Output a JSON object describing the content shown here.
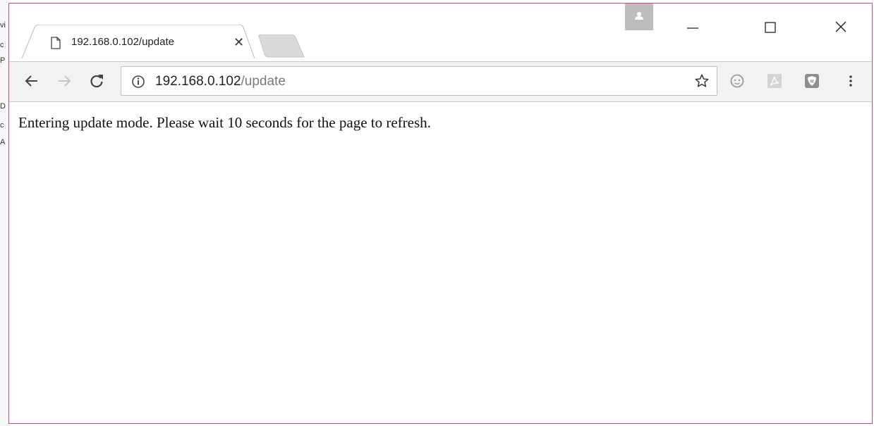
{
  "background_window": {
    "fragments": [
      "vi",
      "c",
      "P",
      "D",
      "c",
      "A"
    ]
  },
  "tab": {
    "title": "192.168.0.102/update",
    "close_glyph": "✕"
  },
  "omnibox": {
    "url_host": "192.168.0.102",
    "url_path": "/update"
  },
  "page": {
    "message": "Entering update mode. Please wait 10 seconds for the page to refresh."
  },
  "icons": {
    "back": "back-arrow-icon",
    "forward": "forward-arrow-icon",
    "reload": "reload-icon",
    "info": "info-icon",
    "star": "bookmark-star-icon",
    "extensions": [
      "emoji-extension-icon",
      "pdf-extension-icon",
      "shield-extension-icon"
    ],
    "menu": "kebab-menu-icon"
  },
  "colors": {
    "window_border": "#c8477f",
    "toolbar_bg": "#f2f2f2",
    "profile_button": "#bdbdbd"
  }
}
